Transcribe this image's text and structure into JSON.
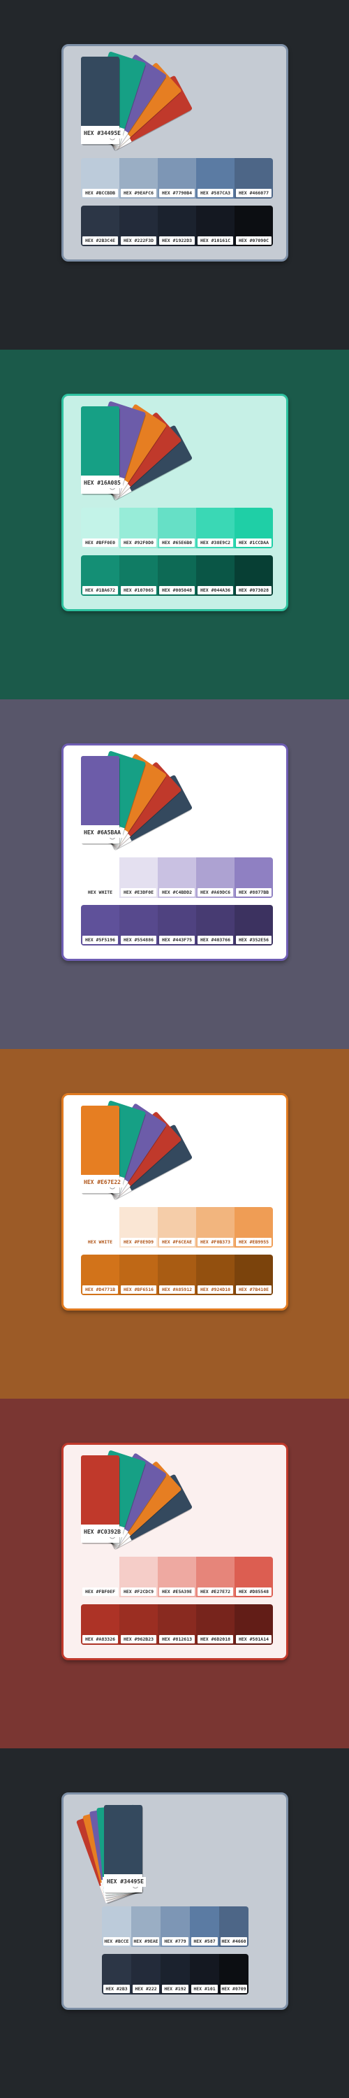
{
  "sections": [
    {
      "id": "slate",
      "bg": "#23272b",
      "card_bg": "#c5cbd3",
      "card_border": "#7d8fa6",
      "main_color": "#34495e",
      "fan_colors": [
        "#c0392b",
        "#e67e22",
        "#6c5ca9",
        "#16a085",
        "#34495e"
      ],
      "main_label": "HEX #34495E",
      "label_color": "#2c2c2c",
      "light": {
        "colors": [
          "#bccbda",
          "#9aaec4",
          "#7d96b5",
          "#5b7ba3",
          "#4d6687"
        ],
        "labels": [
          "HEX #BCCBDB",
          "HEX #9EAFC6",
          "HEX #7790B4",
          "HEX #587CA3",
          "HEX #466077"
        ]
      },
      "dark": {
        "colors": [
          "#2c3646",
          "#232b3a",
          "#1b222e",
          "#141821",
          "#0c0e12"
        ],
        "labels": [
          "HEX #2B3C4E",
          "HEX #222F3D",
          "HEX #1922D3",
          "HEX #10161C",
          "HEX #07090C"
        ]
      }
    },
    {
      "id": "teal",
      "bg": "#1b5a4a",
      "card_bg": "#c6f0e6",
      "card_border": "#2ec2a0",
      "main_color": "#16a085",
      "fan_colors": [
        "#34495e",
        "#c0392b",
        "#e67e22",
        "#6c5ca9",
        "#16a085"
      ],
      "main_label": "HEX #16A085",
      "label_color": "#2c2c2c",
      "light": {
        "colors": [
          "#c3f3e8",
          "#97ecd8",
          "#66e0c6",
          "#3ad8b5",
          "#1fcfa6"
        ],
        "labels": [
          "HEX #BFF0E0",
          "HEX #92F0D0",
          "HEX #65E6B0",
          "HEX #38E9C2",
          "HEX #1CCDAA"
        ]
      },
      "dark": {
        "colors": [
          "#148f75",
          "#107c64",
          "#0d6a55",
          "#0a5646",
          "#073f34"
        ],
        "labels": [
          "HEX #1BA672",
          "HEX #107065",
          "HEX #005048",
          "HEX #044A36",
          "HEX #073028"
        ]
      }
    },
    {
      "id": "purple",
      "bg": "#58566a",
      "card_bg": "#ffffff",
      "card_border": "#6f5eb4",
      "main_color": "#6c5ca9",
      "fan_colors": [
        "#34495e",
        "#c0392b",
        "#e67e22",
        "#16a085",
        "#6c5ca9"
      ],
      "main_label": "HEX #6A5BAA",
      "label_color": "#2c2c2c",
      "light": {
        "colors": [
          "#ffffff",
          "#e4e0f0",
          "#c9c1e2",
          "#ada2d2",
          "#8f80c2"
        ],
        "labels": [
          "HEX WHITE",
          "HEX #E3DF0E",
          "HEX #C4BDD2",
          "HEX #A69DC6",
          "HEX #8877BB"
        ]
      },
      "dark": {
        "colors": [
          "#5f519a",
          "#57498d",
          "#4f4280",
          "#473b72",
          "#3c3260"
        ],
        "labels": [
          "HEX #5F5196",
          "HEX #554886",
          "HEX #443F75",
          "HEX #403766",
          "HEX #352E56"
        ]
      }
    },
    {
      "id": "orange",
      "bg": "#9c5b27",
      "card_bg": "#ffffff",
      "card_border": "#e07a20",
      "main_color": "#e67e22",
      "fan_colors": [
        "#34495e",
        "#c0392b",
        "#6c5ca9",
        "#16a085",
        "#e67e22"
      ],
      "main_label": "HEX #E67E22",
      "label_color": "#b0561a",
      "light": {
        "colors": [
          "#ffffff",
          "#fae6d4",
          "#f5cda9",
          "#f2b57e",
          "#ef9d55"
        ],
        "labels": [
          "HEX WHITE",
          "HEX #F8E9D9",
          "HEX #F6CEAE",
          "HEX #F0B373",
          "HEX #EB9955"
        ]
      },
      "dark": {
        "colors": [
          "#d2731a",
          "#bf6816",
          "#a95c13",
          "#93500f",
          "#7b430c"
        ],
        "labels": [
          "HEX #D4771B",
          "HEX #BF6516",
          "HEX #A85912",
          "HEX #924D10",
          "HEX #7B410E"
        ]
      }
    },
    {
      "id": "red",
      "bg": "#7a3632",
      "card_bg": "#fbf0ef",
      "card_border": "#c0392b",
      "main_color": "#c0392b",
      "fan_colors": [
        "#34495e",
        "#e67e22",
        "#6c5ca9",
        "#16a085",
        "#c0392b"
      ],
      "main_label": "HEX #C0392B",
      "label_color": "#2c2c2c",
      "light": {
        "colors": [
          "#fbf0ef",
          "#f5cdc8",
          "#eea9a1",
          "#e6857a",
          "#dc5e51"
        ],
        "labels": [
          "HEX #FBF0EF",
          "HEX #F2CDC9",
          "HEX #E5A39E",
          "HEX #E27E72",
          "HEX #D85548"
        ]
      },
      "dark": {
        "colors": [
          "#ad3326",
          "#9b2e22",
          "#892a20",
          "#77241c",
          "#621d17"
        ],
        "labels": [
          "HEX #A83326",
          "HEX #962B23",
          "HEX #812613",
          "HEX #6D2018",
          "HEX #581A14"
        ]
      }
    },
    {
      "id": "slate-narrow",
      "bg": "#23272b",
      "card_bg": "#c5cbd3",
      "card_border": "#7d8fa6",
      "main_color": "#34495e",
      "fan_colors": [
        "#c0392b",
        "#e67e22",
        "#6c5ca9",
        "#16a085",
        "#34495e"
      ],
      "main_label": "HEX #34495E",
      "label_color": "#2c2c2c",
      "light": {
        "colors": [
          "#bccbda",
          "#9aaec4",
          "#7d96b5",
          "#5b7ba3",
          "#4d6687"
        ],
        "labels": [
          "HEX #BCCE",
          "HEX #9EAE",
          "HEX #779",
          "HEX #587",
          "HEX #4660"
        ]
      },
      "dark": {
        "colors": [
          "#2c3646",
          "#232b3a",
          "#1b222e",
          "#141821",
          "#0c0e12"
        ],
        "labels": [
          "HEX #2B3",
          "HEX #222",
          "HEX #192",
          "HEX #101",
          "HEX #0709"
        ]
      }
    }
  ]
}
